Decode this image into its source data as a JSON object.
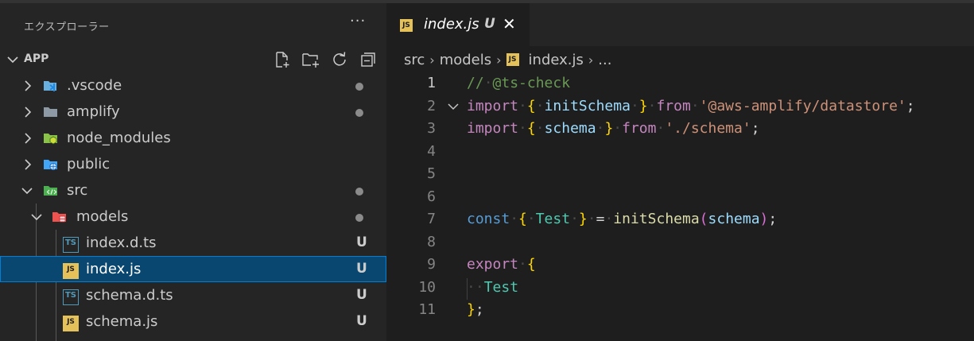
{
  "explorer": {
    "title": "エクスプローラー",
    "more": "···",
    "section": "APP",
    "actions": [
      "new-file-icon",
      "new-folder-icon",
      "refresh-icon",
      "collapse-all-icon"
    ]
  },
  "tree": [
    {
      "label": ".vscode",
      "icon": "vscode-folder-icon",
      "expanded": false,
      "depth": 0,
      "status": "dot"
    },
    {
      "label": "amplify",
      "icon": "folder-icon",
      "expanded": false,
      "depth": 0,
      "status": ""
    },
    {
      "label": "node_modules",
      "icon": "node-folder-icon",
      "expanded": false,
      "depth": 0,
      "status": ""
    },
    {
      "label": "public",
      "icon": "public-folder-icon",
      "expanded": false,
      "depth": 0,
      "status": ""
    },
    {
      "label": "src",
      "icon": "src-folder-icon",
      "expanded": true,
      "depth": 0,
      "status": "dot"
    },
    {
      "label": "models",
      "icon": "models-folder-icon",
      "expanded": true,
      "depth": 1,
      "status": "dot"
    },
    {
      "label": "index.d.ts",
      "icon": "typescript-file-icon",
      "depth": 2,
      "status": "U"
    },
    {
      "label": "index.js",
      "icon": "javascript-file-icon",
      "depth": 2,
      "status": "U",
      "selected": true
    },
    {
      "label": "schema.d.ts",
      "icon": "typescript-file-icon",
      "depth": 2,
      "status": "U"
    },
    {
      "label": "schema.js",
      "icon": "javascript-file-icon",
      "depth": 2,
      "status": "U"
    }
  ],
  "tab": {
    "icon_text": "JS",
    "ts_icon_text": "TS",
    "name": "index.js",
    "status": "U",
    "close": "✕"
  },
  "breadcrumb": {
    "parts": [
      "src",
      "models",
      "index.js",
      "..."
    ],
    "sep": "›"
  },
  "code": {
    "line_numbers": [
      "1",
      "2",
      "3",
      "4",
      "5",
      "6",
      "7",
      "8",
      "9",
      "10",
      "11"
    ],
    "active_line": "1"
  },
  "colors": {
    "sidebar_bg": "#252526",
    "editor_bg": "#1e1e1e",
    "selection_bg": "#094771",
    "selection_border": "#007fd4",
    "keyword": "#c586c0",
    "const_keyword": "#569cd6",
    "variable": "#9cdcfe",
    "class": "#4ec9b0",
    "function": "#dcdcaa",
    "string": "#ce9178",
    "comment": "#6a9955",
    "bracket_gold": "#ffd700"
  }
}
